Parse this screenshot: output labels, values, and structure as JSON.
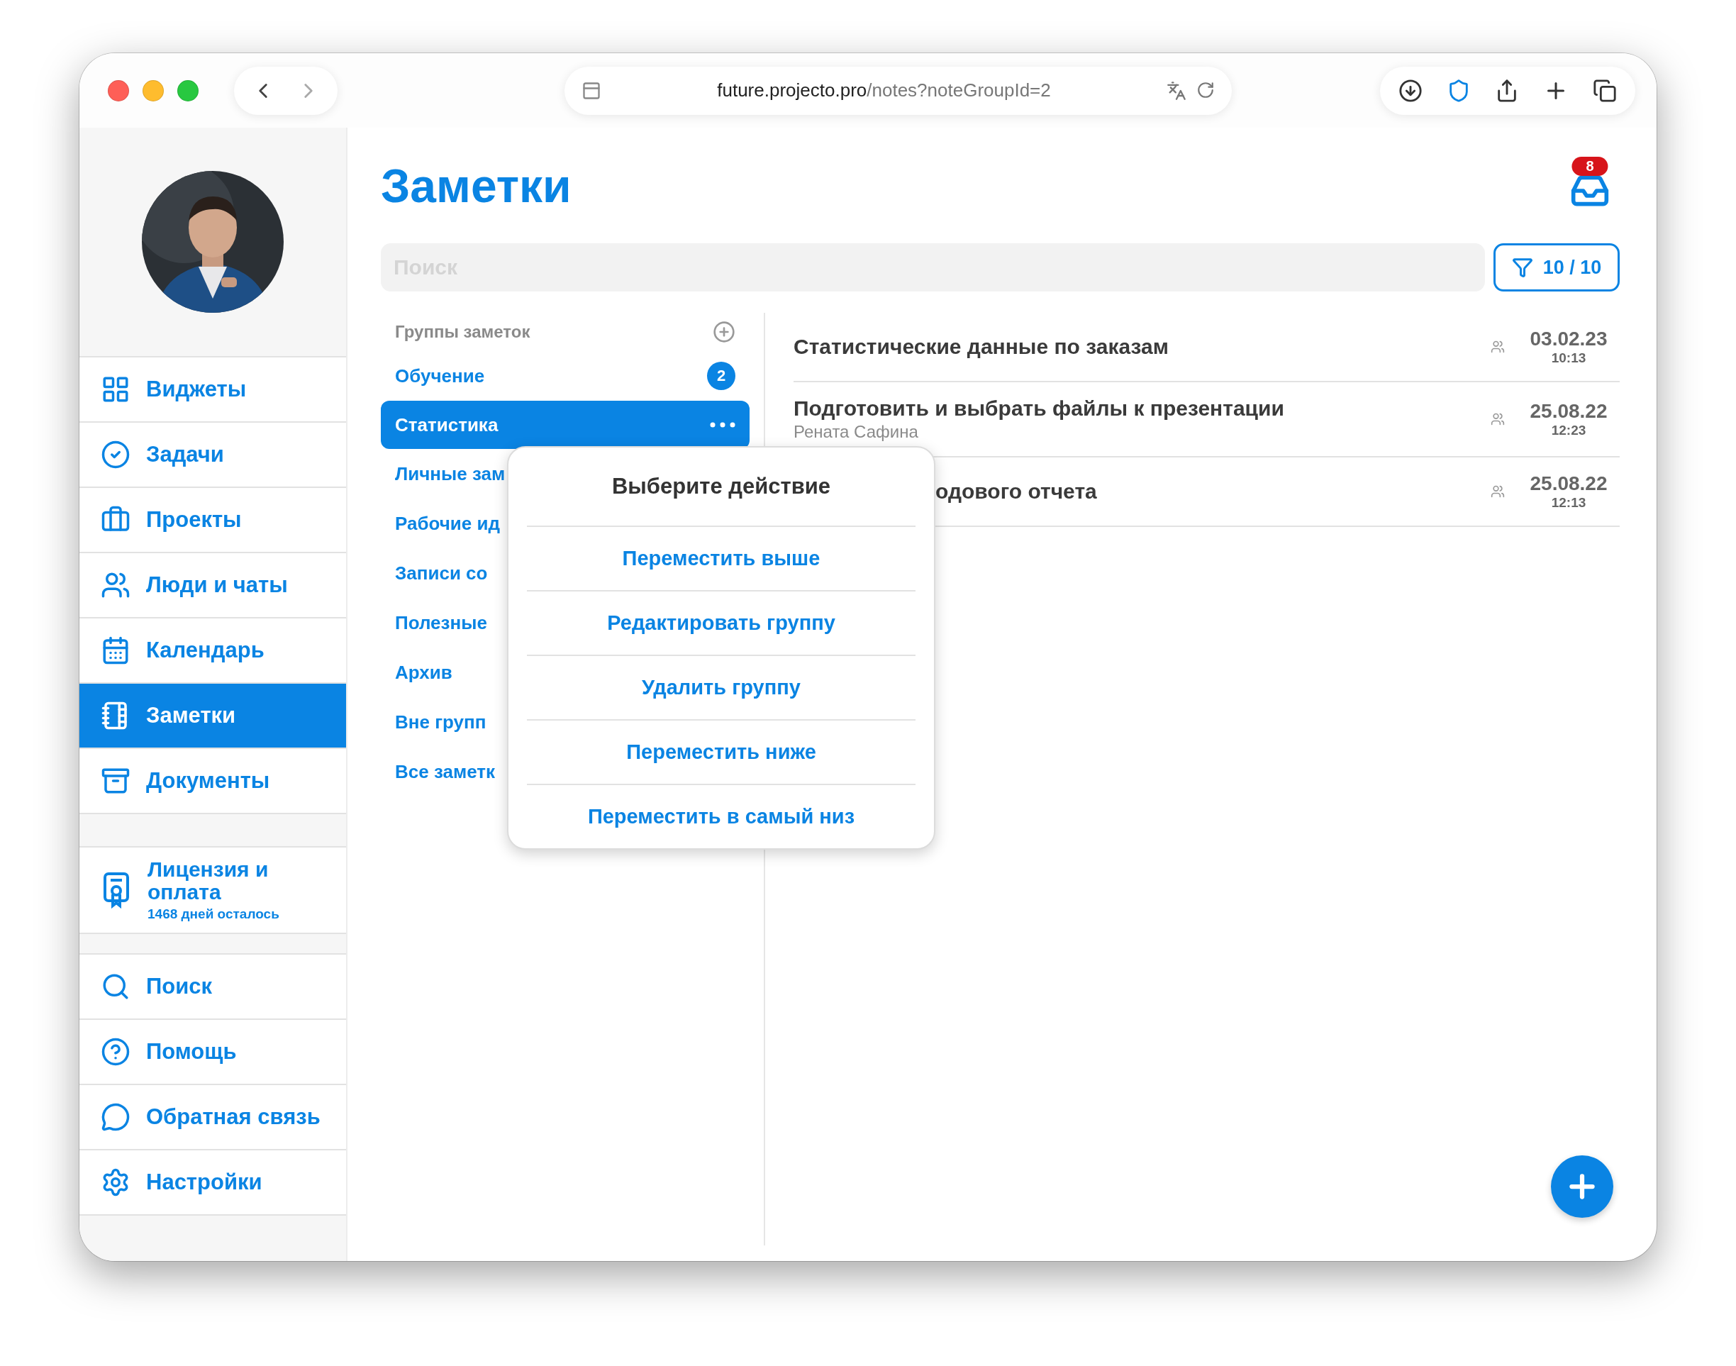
{
  "browser": {
    "url_domain": "future.projecto.pro",
    "url_path": "/notes?noteGroupId=2"
  },
  "sidebar": {
    "sections": [
      {
        "kind": "nav",
        "items": [
          {
            "label": "Виджеты",
            "selected": false
          },
          {
            "label": "Задачи",
            "selected": false
          },
          {
            "label": "Проекты",
            "selected": false
          },
          {
            "label": "Люди и чаты",
            "selected": false
          },
          {
            "label": "Календарь",
            "selected": false
          },
          {
            "label": "Заметки",
            "selected": true
          },
          {
            "label": "Документы",
            "selected": false
          }
        ]
      },
      {
        "kind": "license",
        "items": [
          {
            "label": "Лицензия и оплата",
            "note": "1468 дней осталось",
            "selected": false
          }
        ]
      },
      {
        "kind": "nav",
        "items": [
          {
            "label": "Поиск",
            "selected": false
          },
          {
            "label": "Помощь",
            "selected": false
          },
          {
            "label": "Обратная связь",
            "selected": false
          },
          {
            "label": "Настройки",
            "selected": false
          }
        ]
      }
    ]
  },
  "page": {
    "title": "Заметки",
    "inbox_badge": "8",
    "search": {
      "placeholder": "Поиск"
    },
    "filter": "10 / 10"
  },
  "groups": {
    "header": "Группы заметок",
    "items": [
      {
        "label": "Обучение",
        "badge": "2",
        "selected": false
      },
      {
        "label": "Статистика",
        "selected": true
      },
      {
        "label": "Личные зам",
        "selected": false
      },
      {
        "label": "Рабочие ид",
        "selected": false
      },
      {
        "label": "Записи со",
        "selected": false
      },
      {
        "label": "Полезные",
        "selected": false
      },
      {
        "label": "Архив",
        "selected": false
      },
      {
        "label": "Вне групп",
        "selected": false
      },
      {
        "label": "Все заметк",
        "selected": false
      }
    ]
  },
  "notes": [
    {
      "title": "Статистические данные по заказам",
      "date": "03.02.23",
      "time": "10:13",
      "covered": false
    },
    {
      "title": "Подготовить и выбрать файлы к презентации",
      "author": "Рената Сафина",
      "date": "25.08.22",
      "time": "12:23",
      "covered": false
    },
    {
      "title": "одового отчета",
      "date": "25.08.22",
      "time": "12:13",
      "covered": true
    }
  ],
  "popup": {
    "title": "Выберите действие",
    "actions": [
      "Переместить выше",
      "Редактировать группу",
      "Удалить группу",
      "Переместить ниже",
      "Переместить в самый низ"
    ]
  }
}
